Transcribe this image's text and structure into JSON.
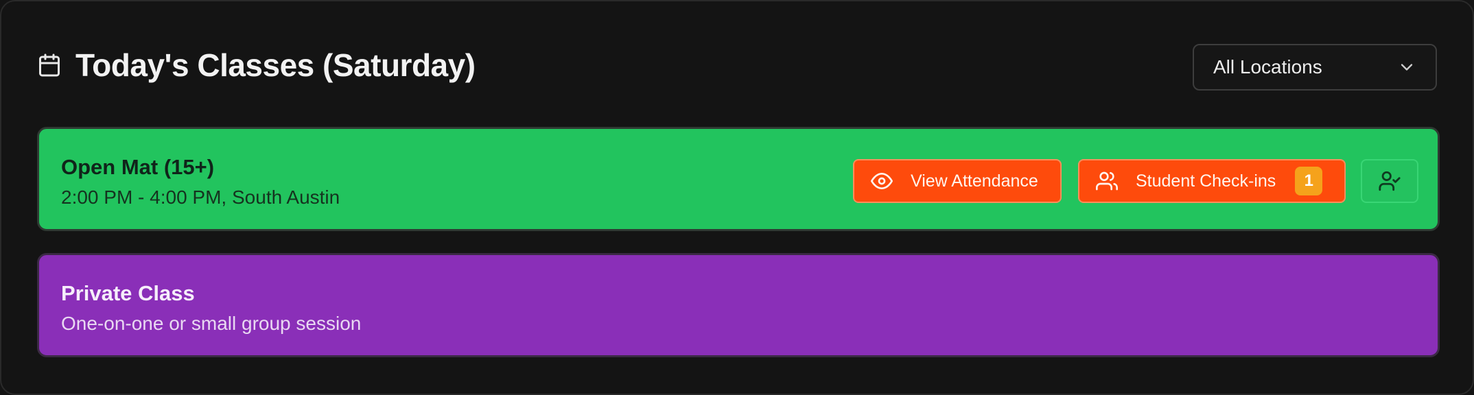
{
  "header": {
    "title": "Today's Classes (Saturday)",
    "title_icon": "calendar-icon"
  },
  "location_filter": {
    "selected": "All Locations",
    "icon": "chevron-down-icon"
  },
  "classes": [
    {
      "name": "Open Mat (15+)",
      "details": "2:00 PM - 4:00 PM, South Austin",
      "color": "#22c45e",
      "actions": {
        "view_attendance_label": "View Attendance",
        "view_attendance_icon": "eye-icon",
        "student_checkins_label": "Student Check-ins",
        "student_checkins_icon": "users-icon",
        "student_checkins_count": "1",
        "mark_attendance_icon": "user-check-icon"
      }
    },
    {
      "name": "Private Class",
      "details": "One-on-one or small group session",
      "color": "#8a2fb8"
    }
  ],
  "colors": {
    "background": "#141414",
    "accent_button": "#fe4b0c",
    "badge": "#f5a21b"
  }
}
